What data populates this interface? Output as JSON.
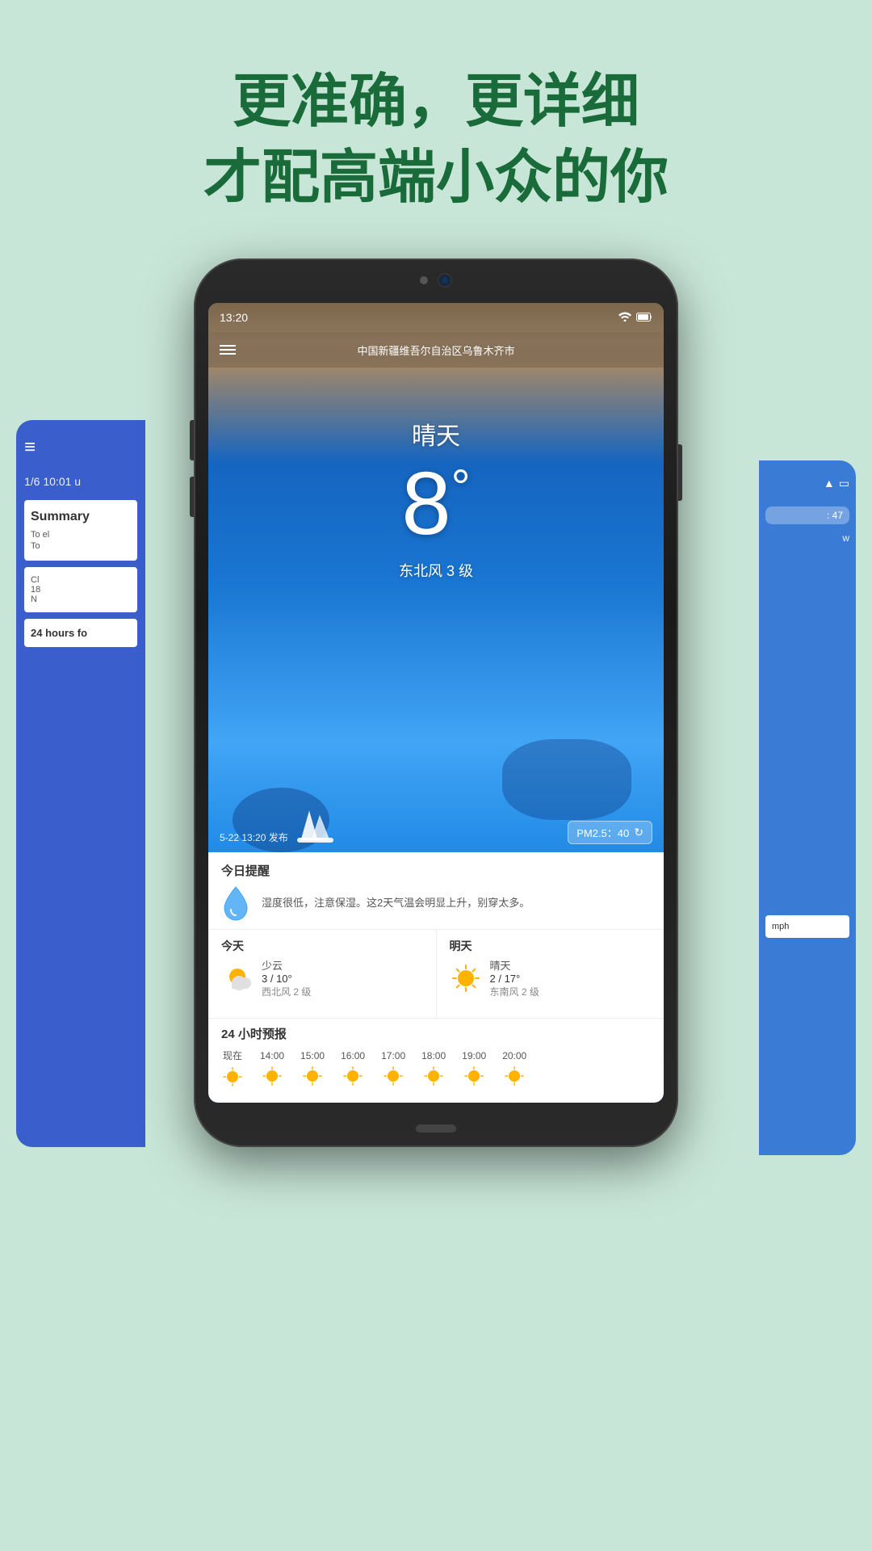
{
  "tagline": {
    "line1": "更准确，更详细",
    "line2": "才配高端小众的你"
  },
  "phone_main": {
    "status_bar": {
      "time": "13:20",
      "wifi": "📶",
      "battery": "🔋"
    },
    "location": "中国新疆维吾尔自治区乌鲁木齐市",
    "weather": {
      "condition": "晴天",
      "temperature": "8",
      "degree_symbol": "°",
      "wind": "东北风 3 级",
      "publish_time": "5-22 13:20 发布",
      "pm_label": "PM2.5：40",
      "refresh_icon": "↻"
    },
    "reminder": {
      "title": "今日提醒",
      "text": "湿度很低，注意保湿。这2天气温会明显上升，别穿太多。"
    },
    "forecast_today": {
      "day": "今天",
      "condition": "少云",
      "temp_range": "3 / 10°",
      "wind": "西北风 2 级"
    },
    "forecast_tomorrow": {
      "day": "明天",
      "condition": "晴天",
      "temp_range": "2 / 17°",
      "wind": "东南风 2 级"
    },
    "hours_header": "24 小时预报",
    "hours": [
      {
        "label": "现在",
        "icon": "sun"
      },
      {
        "label": "14:00",
        "icon": "sun"
      },
      {
        "label": "15:00",
        "icon": "sun"
      },
      {
        "label": "16:00",
        "icon": "sun"
      },
      {
        "label": "17:00",
        "icon": "sun"
      },
      {
        "label": "18:00",
        "icon": "sun"
      },
      {
        "label": "19:00",
        "icon": "sun"
      },
      {
        "label": "20:00",
        "icon": "sun"
      }
    ]
  },
  "phone_left": {
    "date": "1/6 10:01 u",
    "summary_title": "Summary",
    "summary_text": "To el",
    "today_label": "To",
    "detail1": "Cl",
    "detail2": "18",
    "detail3": "N",
    "hours_label": "24 hours fo"
  },
  "phone_right": {
    "time_badge": ": 47",
    "label_w": "w",
    "label_mph": "mph"
  },
  "colors": {
    "bg": "#c8e6d8",
    "tagline": "#1a6b3a",
    "phone_blue": "#2196f3",
    "card_white": "#ffffff"
  }
}
